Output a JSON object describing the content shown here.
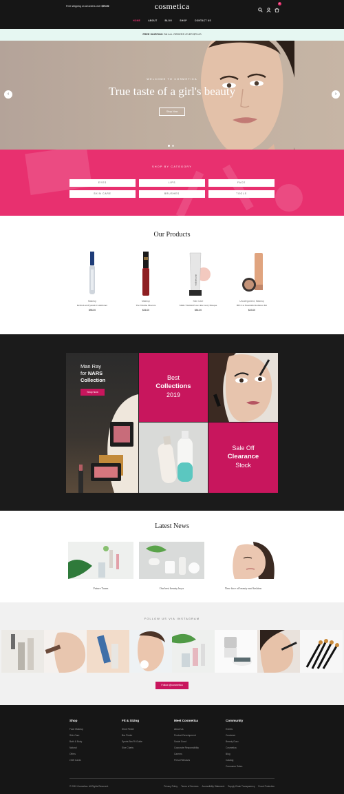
{
  "topbar": {
    "shipping_text": "Free shipping on all orders over",
    "shipping_amount": "$75.00",
    "logo": "cosmetica",
    "cart_count": "0",
    "icons": [
      "search-icon",
      "user-icon",
      "cart-icon"
    ],
    "nav": [
      "HOME",
      "ABOUT",
      "BLOG",
      "SHOP",
      "CONTACT US"
    ]
  },
  "shipbar": {
    "bold": "FREE SHIPPING",
    "text": "ON ALL ORDERS OVER $75.00"
  },
  "hero": {
    "welcome": "WELCOME TO COSMETICA",
    "title": "True taste of a girl's beauty",
    "button": "Shop Now",
    "prev": "‹",
    "next": "›"
  },
  "category": {
    "label": "SHOP BY CATEGORY",
    "items": [
      "EYES",
      "LIPS",
      "FACE",
      "SKIN CARE",
      "BRUSHES",
      "TOOLS"
    ]
  },
  "products": {
    "title": "Our Products",
    "items": [
      {
        "category": "Makeup",
        "name": "RevitaLash Eyelash Conditioner",
        "price": "$98.00"
      },
      {
        "category": "Makeup",
        "name": "The Volume Mascara",
        "price": "$26.00"
      },
      {
        "category": "Skin Care",
        "name": "Multi-Vitamin Power Recovery Masque",
        "price": "$54.00"
      },
      {
        "category": "Uncategorized, Makeup",
        "name": "BECCA Essentials Radiance Kit",
        "price": "$23.00"
      }
    ]
  },
  "promo": {
    "nars_line1": "Man Ray",
    "nars_line2a": "for",
    "nars_line2b": "NARS",
    "nars_line3": "Collection",
    "nars_button": "Shop Now",
    "best_line1": "Best",
    "best_line2": "Collections",
    "best_line3": "2019",
    "sale_line1": "Sale Off",
    "sale_line2": "Clearance",
    "sale_line3": "Stock"
  },
  "news": {
    "title": "Latest News",
    "items": [
      "Future Tones",
      "Our best beauty buys",
      "New face of beauty and fashion"
    ]
  },
  "insta": {
    "label": "FOLLOW US VIA INSTAGRAM",
    "button": "Follow @cosmetica"
  },
  "footer": {
    "cols": [
      {
        "title": "Shop",
        "links": [
          "Face Makeup",
          "Skin Care",
          "Bath & Body",
          "Natural",
          "Offers",
          "eGift Cards"
        ]
      },
      {
        "title": "Fit & Sizing",
        "links": [
          "Shoe Finder",
          "Bra Finder",
          "Sports Bra Fit Guide",
          "Size Charts"
        ]
      },
      {
        "title": "Meet Cosmetica",
        "links": [
          "About Us",
          "Product Development",
          "Social Good",
          "Corporate Responsibility",
          "Careers",
          "Press Releases"
        ]
      },
      {
        "title": "Community",
        "links": [
          "Events",
          "Customer",
          "Beauty Guru",
          "Cosmetica",
          "Blog",
          "Catalog",
          "Consumer Sales"
        ]
      }
    ],
    "copyright": "© 2019 Cosmetica. All Rights Reserved.",
    "legal": [
      "Privacy Policy",
      "Terms of Services",
      "Accessibility Statement",
      "Supply Chain Transparency",
      "Fraud Protection"
    ]
  },
  "colors": {
    "accent": "#e8306f",
    "promo_pink": "#c8165d",
    "dark": "#161616"
  }
}
